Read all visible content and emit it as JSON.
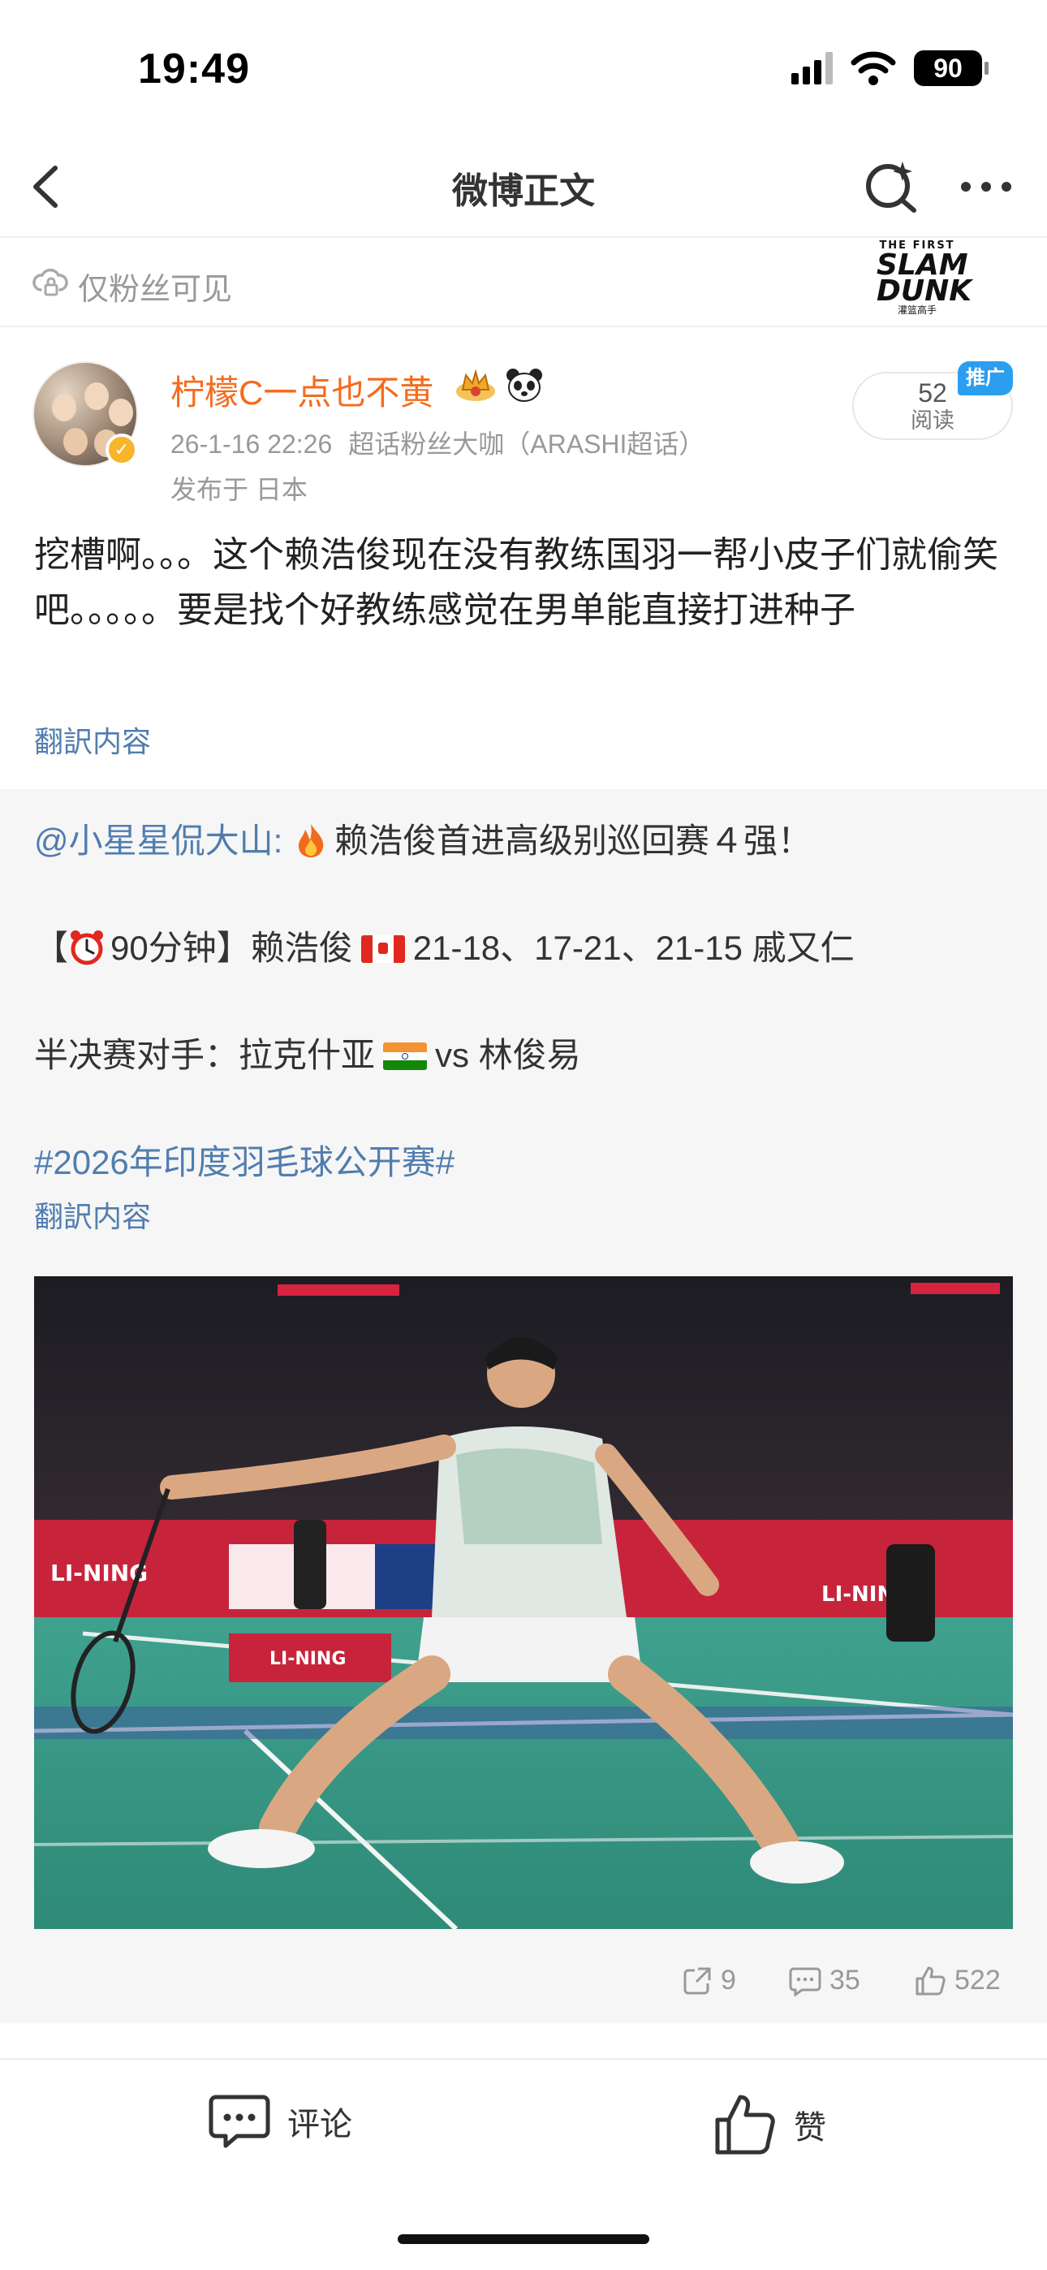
{
  "status_bar": {
    "time": "19:49",
    "battery": "90"
  },
  "nav": {
    "title": "微博正文",
    "back_icon": "chevron-left-icon",
    "search_icon": "search-sparkle-icon",
    "more_icon": "more-dots-icon"
  },
  "visibility": {
    "text": "仅粉丝可见",
    "icon": "cloud-lock-icon"
  },
  "logo": {
    "line1": "THE FIRST",
    "line2a": "SLAM",
    "line2b": "DUNK",
    "line3": "灌篮高手"
  },
  "author": {
    "name": "柠檬C一点也不黄",
    "timestamp": "26-1-16 22:26",
    "source": "超话粉丝大咖（ARASHI超话）",
    "location": "发布于 日本",
    "read_count": "52",
    "read_label": "阅读",
    "promo_label": "推广"
  },
  "post": {
    "text": "挖槽啊。。。这个赖浩俊现在没有教练国羽一帮小皮子们就偷笑吧。。。。。要是找个好教练感觉在男单能直接打进种子",
    "translate": "翻訳内容"
  },
  "repost": {
    "author_link": "@小星星侃大山:",
    "headline": "赖浩俊首进高级别巡回赛４强！",
    "match_prefix": "【",
    "match_time": "90分钟】赖浩俊",
    "match_score": "21-18、17-21、21-15 戚又仁",
    "semi_prefix": "半决赛对手：拉克什亚",
    "semi_suffix": "vs 林俊易",
    "hashtag": "#2026年印度羽毛球公开赛#",
    "translate": "翻訳内容",
    "image_alt": "badminton-player-lunge-photo",
    "banner_text": "LI-NING",
    "stats": {
      "reposts": "9",
      "comments": "35",
      "likes": "522"
    }
  },
  "bottom_bar": {
    "comment_label": "评论",
    "like_label": "赞"
  },
  "colors": {
    "accent_orange": "#f56b1e",
    "link_blue": "#507daf",
    "promo_blue": "#2c9ef0"
  }
}
